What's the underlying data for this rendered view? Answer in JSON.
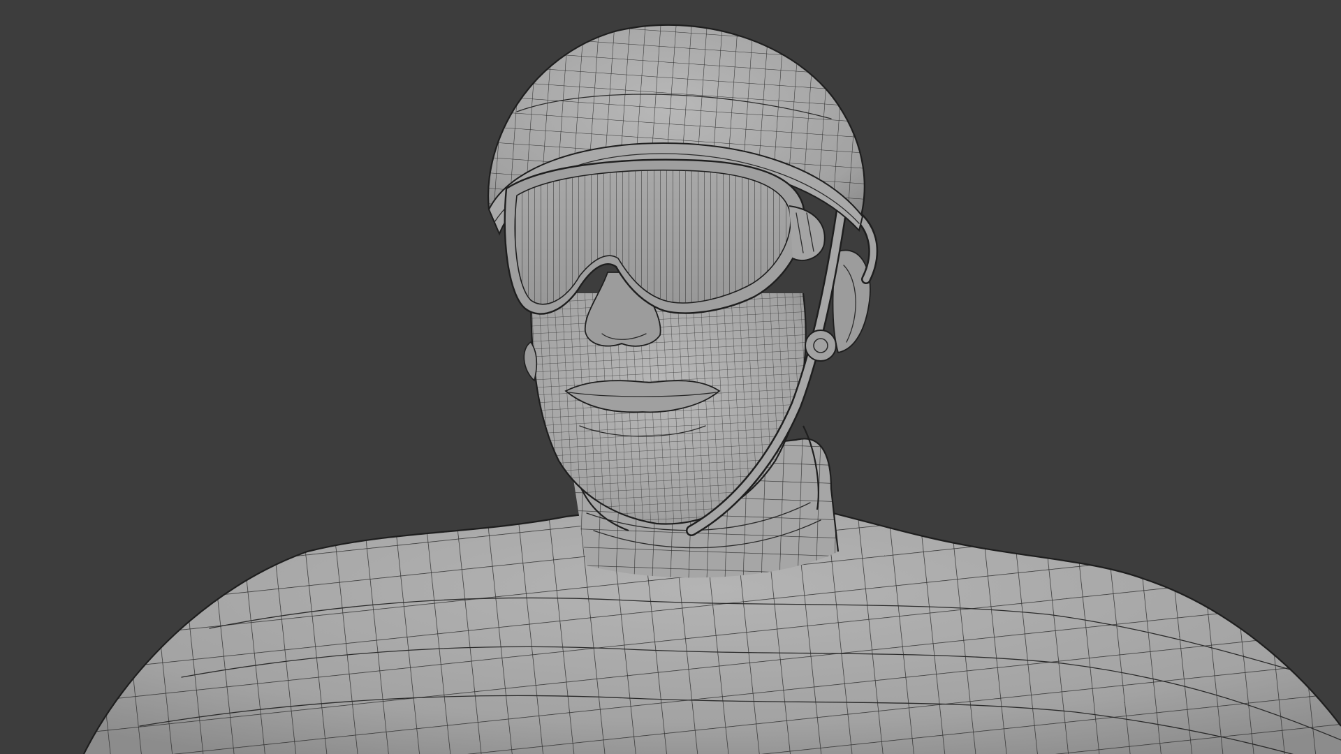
{
  "app": {
    "view": "3d-viewport"
  },
  "scene": {
    "background_color": "#3d3d3d",
    "mesh_color": "#a9a9a9",
    "mesh_shadow_color": "#8a8a8a",
    "wire_color": "#2a2a2a",
    "shading": "solid-wireframe-overlay",
    "subject": "character-mesh"
  }
}
